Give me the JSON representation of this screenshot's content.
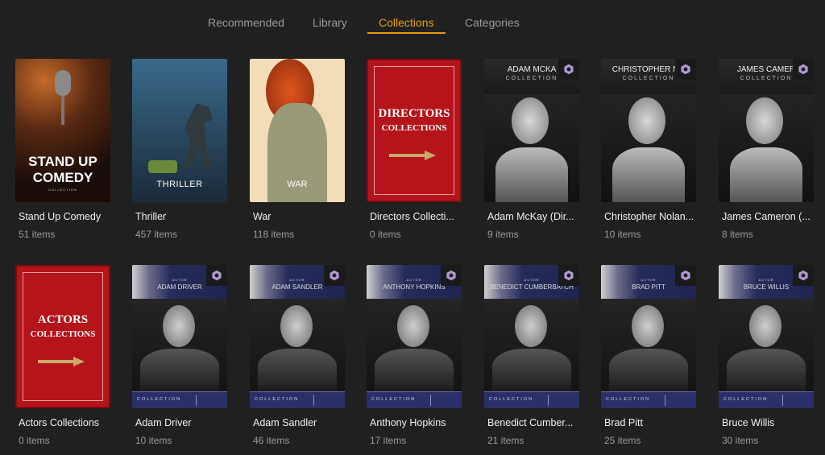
{
  "tabs": [
    {
      "label": "Recommended",
      "active": false
    },
    {
      "label": "Library",
      "active": false
    },
    {
      "label": "Collections",
      "active": true
    },
    {
      "label": "Categories",
      "active": false
    }
  ],
  "accent_color": "#e5a00d",
  "rows": [
    [
      {
        "title": "Stand Up Comedy",
        "count": "51 items",
        "poster": {
          "type": "comedy",
          "lines": [
            "STAND UP",
            "COMEDY"
          ],
          "sub": "COLLECTION"
        }
      },
      {
        "title": "Thriller",
        "count": "457 items",
        "poster": {
          "type": "thriller",
          "lines": [
            "THRILLER"
          ]
        }
      },
      {
        "title": "War",
        "count": "118 items",
        "poster": {
          "type": "war",
          "lines": [
            "WAR"
          ]
        }
      },
      {
        "title": "Directors Collecti...",
        "count": "0 items",
        "poster": {
          "type": "red",
          "lines": [
            "DIRECTORS",
            "COLLECTIONS"
          ]
        }
      },
      {
        "title": "Adam McKay (Dir...",
        "count": "9 items",
        "poster": {
          "type": "director",
          "lines": [
            "ADAM MCKA",
            "COLLECTION"
          ],
          "icon": "plex-hex-icon"
        }
      },
      {
        "title": "Christopher Nolan...",
        "count": "10 items",
        "poster": {
          "type": "director",
          "lines": [
            "CHRISTOPHER NO",
            "COLLECTION"
          ],
          "icon": "plex-hex-icon"
        }
      },
      {
        "title": "James Cameron (...",
        "count": "8 items",
        "poster": {
          "type": "director",
          "lines": [
            "JAMES CAMER",
            "COLLECTION"
          ],
          "icon": "plex-hex-icon"
        }
      }
    ],
    [
      {
        "title": "Actors Collections",
        "count": "0 items",
        "poster": {
          "type": "red",
          "lines": [
            "ACTORS",
            "COLLECTIONS"
          ]
        }
      },
      {
        "title": "Adam Driver",
        "count": "10 items",
        "poster": {
          "type": "actor",
          "lines": [
            "ACTOR",
            "ADAM DRIVER",
            "COLLECTION"
          ],
          "icon": "plex-hex-icon"
        }
      },
      {
        "title": "Adam Sandler",
        "count": "46 items",
        "poster": {
          "type": "actor",
          "lines": [
            "ACTOR",
            "ADAM SANDLER",
            "COLLECTION"
          ],
          "icon": "plex-hex-icon"
        }
      },
      {
        "title": "Anthony Hopkins",
        "count": "17 items",
        "poster": {
          "type": "actor",
          "lines": [
            "ACTOR",
            "ANTHONY HOPKINS",
            "COLLECTION"
          ],
          "icon": "plex-hex-icon"
        }
      },
      {
        "title": "Benedict Cumber...",
        "count": "21 items",
        "poster": {
          "type": "actor",
          "lines": [
            "ACTOR",
            "BENEDICT CUMBERBATCH",
            "COLLECTION"
          ],
          "icon": "plex-hex-icon"
        }
      },
      {
        "title": "Brad Pitt",
        "count": "25 items",
        "poster": {
          "type": "actor",
          "lines": [
            "ACTOR",
            "BRAD PITT",
            "COLLECTION"
          ],
          "icon": "plex-hex-icon"
        }
      },
      {
        "title": "Bruce Willis",
        "count": "30 items",
        "poster": {
          "type": "actor",
          "lines": [
            "ACTOR",
            "BRUCE WILLIS",
            "COLLECTION"
          ],
          "icon": "plex-hex-icon"
        }
      }
    ]
  ]
}
